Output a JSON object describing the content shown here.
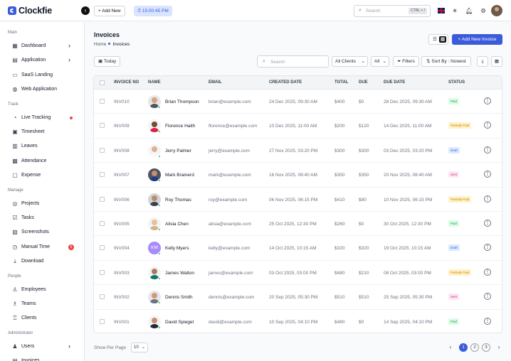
{
  "app": {
    "name": "Clockfie"
  },
  "topbar": {
    "add_new": "+ Add New",
    "timer": "⏱ 15:00:45 PM",
    "search_placeholder": "Search",
    "search_shortcut": "CTRL + /"
  },
  "sidebar": {
    "sections": [
      {
        "title": "Main",
        "items": [
          {
            "label": "Dashboard",
            "icon": "dashboard-icon",
            "chevron": true
          },
          {
            "label": "Application",
            "icon": "application-icon",
            "chevron": true
          },
          {
            "label": "SaaS Landing",
            "icon": "saas-icon"
          },
          {
            "label": "Web Application",
            "icon": "web-icon"
          }
        ]
      },
      {
        "title": "Track",
        "items": [
          {
            "label": "Live Tracking",
            "icon": "live-tracking-icon",
            "live_dot": true
          },
          {
            "label": "Timesheet",
            "icon": "timesheet-icon"
          },
          {
            "label": "Leaves",
            "icon": "leaves-icon"
          },
          {
            "label": "Attendance",
            "icon": "attendance-icon"
          },
          {
            "label": "Expense",
            "icon": "expense-icon"
          }
        ]
      },
      {
        "title": "Manage",
        "items": [
          {
            "label": "Projects",
            "icon": "projects-icon"
          },
          {
            "label": "Tasks",
            "icon": "tasks-icon"
          },
          {
            "label": "Screenshots",
            "icon": "screenshots-icon"
          },
          {
            "label": "Manual Time",
            "icon": "manual-time-icon",
            "count": "5"
          },
          {
            "label": "Download",
            "icon": "download-icon"
          }
        ]
      },
      {
        "title": "People",
        "items": [
          {
            "label": "Employees",
            "icon": "employees-icon"
          },
          {
            "label": "Teams",
            "icon": "teams-icon"
          },
          {
            "label": "Clients",
            "icon": "clients-icon"
          }
        ]
      },
      {
        "title": "Administrator",
        "items": [
          {
            "label": "Users",
            "icon": "users-icon",
            "chevron": true
          },
          {
            "label": "Invoices",
            "icon": "invoices-icon"
          }
        ]
      }
    ]
  },
  "page": {
    "title": "Invoices",
    "breadcrumb": [
      "Home",
      "Invoices"
    ],
    "add_invoice": "+ Add New Invoice"
  },
  "filters": {
    "today": "Today",
    "search_placeholder": "Search",
    "clients": "All Clients",
    "all": "All",
    "filters": "Filters",
    "sort": "Sort By : Nowest"
  },
  "table": {
    "columns": [
      "INVOICE NO",
      "NAME",
      "EMAIL",
      "CREATED DATE",
      "TOTAL",
      "DUE",
      "DUE DATE",
      "STATUS"
    ],
    "rows": [
      {
        "invoice": "INV010",
        "name": "Brian Thompson",
        "email": "brian@example.com",
        "created": "24 Dec 2025, 09:30 AM",
        "total": "$400",
        "due": "$0",
        "due_date": "28 Dec 2025, 09:30 AM",
        "status": "Paid",
        "avatar": {
          "bg": "#e5e7eb",
          "skin": "#d8a27a",
          "shirt": "#4b5563"
        }
      },
      {
        "invoice": "INV009",
        "name": "Florence Haith",
        "email": "florence@example.com",
        "created": "10 Dec 2025, 11:00 AM",
        "total": "$200",
        "due": "$120",
        "due_date": "14 Dec 2025, 11:00 AM",
        "status": "Partially Paid",
        "avatar": {
          "bg": "#f3f4f6",
          "skin": "#7a4a2e",
          "shirt": "#e11d48"
        }
      },
      {
        "invoice": "INV008",
        "name": "Jerry Palmer",
        "email": "jerry@example.com",
        "created": "27 Nov 2025, 03:20 PM",
        "total": "$300",
        "due": "$300",
        "due_date": "03 Dec 2025, 03:20 PM",
        "status": "Draft",
        "avatar": {
          "bg": "#f3f4f6",
          "skin": "#e0b090",
          "shirt": "#f9fafb"
        }
      },
      {
        "invoice": "INV007",
        "name": "Mark Brainerd",
        "email": "mark@example.com",
        "created": "16 Nov 2025, 08:40 AM",
        "total": "$350",
        "due": "$350",
        "due_date": "20 Nov 2025, 08:40 AM",
        "status": "Sent",
        "avatar": {
          "bg": "#4b5563",
          "skin": "#c98d6b",
          "shirt": "#1e3a8a"
        }
      },
      {
        "invoice": "INV006",
        "name": "Roy Thomas",
        "email": "roy@example.com",
        "created": "06 Nov 2025, 06:15 PM",
        "total": "$410",
        "due": "$80",
        "due_date": "10 Nov 2025, 06:15 PM",
        "status": "Partially Paid",
        "avatar": {
          "bg": "#d1d5db",
          "skin": "#c08a66",
          "shirt": "#374151"
        }
      },
      {
        "invoice": "INV005",
        "name": "Alisia Chen",
        "email": "alisia@example.com",
        "created": "25 Oct 2025, 12:30 PM",
        "total": "$260",
        "due": "$0",
        "due_date": "30 Oct 2025, 12:30 PM",
        "status": "Paid",
        "avatar": {
          "bg": "#f3f4f6",
          "skin": "#e8c09a",
          "shirt": "#d6b38a"
        }
      },
      {
        "invoice": "INV004",
        "name": "Kelly Myers",
        "email": "kelly@example.com",
        "created": "14 Oct 2025, 10:15 AM",
        "total": "$320",
        "due": "$320",
        "due_date": "19 Oct 2025, 10:15 AM",
        "status": "Draft",
        "avatar": {
          "bg": "#a78bfa",
          "initials": "KM"
        }
      },
      {
        "invoice": "INV003",
        "name": "James Walton",
        "email": "james@example.com",
        "created": "03 Oct 2025, 03:00 PM",
        "total": "$480",
        "due": "$210",
        "due_date": "08 Oct 2025, 03:00 PM",
        "status": "Partially Paid",
        "avatar": {
          "bg": "#f3f4f6",
          "skin": "#b07a5a",
          "shirt": "#0f766e"
        }
      },
      {
        "invoice": "INV002",
        "name": "Dennis Smith",
        "email": "dennis@example.com",
        "created": "20 Sep 2025, 05:30 PM",
        "total": "$510",
        "due": "$510",
        "due_date": "25 Sep 2025, 05:30 PM",
        "status": "Sent",
        "avatar": {
          "bg": "#e5e7eb",
          "skin": "#d09a78",
          "shirt": "#6b7280"
        }
      },
      {
        "invoice": "INV001",
        "name": "David Spiegel",
        "email": "david@example.com",
        "created": "10 Sep 2025, 04:10 PM",
        "total": "$480",
        "due": "$0",
        "due_date": "14 Sep 2025, 04:10 PM",
        "status": "Paid",
        "avatar": {
          "bg": "#f3f4f6",
          "skin": "#c99070",
          "shirt": "#1f2937"
        }
      }
    ]
  },
  "status_colors": {
    "Paid": {
      "bg": "#dcfce7",
      "fg": "#16a34a"
    },
    "Partially Paid": {
      "bg": "#fef3c7",
      "fg": "#d97706"
    },
    "Draft": {
      "bg": "#dbeafe",
      "fg": "#2563eb"
    },
    "Sent": {
      "bg": "#fce7f3",
      "fg": "#db2777"
    }
  },
  "footer": {
    "per_page_label": "Show Per Page",
    "per_page_value": "10",
    "pages": [
      "1",
      "2",
      "3"
    ],
    "current_page": "1"
  }
}
